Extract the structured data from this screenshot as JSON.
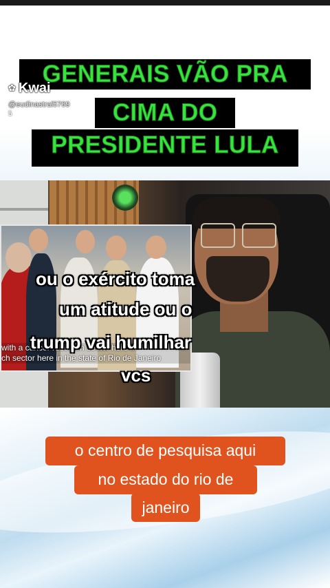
{
  "title": {
    "line1": "GENERAIS VÃO PRA",
    "line2": "CIMA DO",
    "line3": "PRESIDENTE LULA"
  },
  "watermark": {
    "brand": "Kwai",
    "handle": "@eudinastral5769",
    "handle_extra": "5"
  },
  "video": {
    "subtitles": [
      "ou o exército toma",
      "um atitude ou o",
      "trump vai humilhar",
      "vcs"
    ],
    "inset_caption_line1": "with a cancer research sector here in",
    "inset_caption_line2": "ch sector here in the state of Rio de Janeiro"
  },
  "caption": {
    "line1": "o centro de pesquisa aqui",
    "line2": "no estado do rio de",
    "line3": "janeiro"
  },
  "colors": {
    "title_text": "#39e33d",
    "title_bg": "#000000",
    "caption_bg": "#e0531e"
  }
}
